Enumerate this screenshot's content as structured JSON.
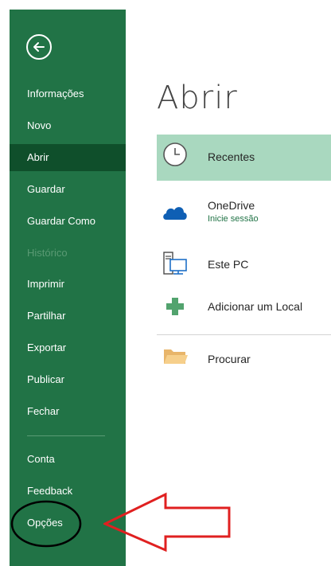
{
  "sidebar": {
    "items": [
      {
        "label": "Informações",
        "name": "sidebar-item-informacoes"
      },
      {
        "label": "Novo",
        "name": "sidebar-item-novo"
      },
      {
        "label": "Abrir",
        "name": "sidebar-item-abrir",
        "selected": true
      },
      {
        "label": "Guardar",
        "name": "sidebar-item-guardar"
      },
      {
        "label": "Guardar Como",
        "name": "sidebar-item-guardar-como"
      },
      {
        "label": "Histórico",
        "name": "sidebar-item-historico",
        "disabled": true
      },
      {
        "label": "Imprimir",
        "name": "sidebar-item-imprimir"
      },
      {
        "label": "Partilhar",
        "name": "sidebar-item-partilhar"
      },
      {
        "label": "Exportar",
        "name": "sidebar-item-exportar"
      },
      {
        "label": "Publicar",
        "name": "sidebar-item-publicar"
      },
      {
        "label": "Fechar",
        "name": "sidebar-item-fechar"
      },
      {
        "label": "Conta",
        "name": "sidebar-item-conta"
      },
      {
        "label": "Feedback",
        "name": "sidebar-item-feedback"
      },
      {
        "label": "Opções",
        "name": "sidebar-item-opcoes"
      }
    ]
  },
  "main": {
    "title": "Abrir",
    "places": [
      {
        "label": "Recentes",
        "icon": "clock-icon",
        "selected": true
      },
      {
        "label": "OneDrive",
        "sublabel": "Inicie sessão",
        "icon": "onedrive-cloud-icon"
      },
      {
        "label": "Este PC",
        "icon": "computer-icon"
      },
      {
        "label": "Adicionar um Local",
        "icon": "plus-icon"
      },
      {
        "label": "Procurar",
        "icon": "folder-icon"
      }
    ]
  },
  "colors": {
    "sidebar_bg": "#217346",
    "sidebar_selected": "#0f4f2b",
    "place_selected": "#a9d8bf",
    "annotation_arrow": "#e02020",
    "annotation_ellipse": "#000000"
  }
}
